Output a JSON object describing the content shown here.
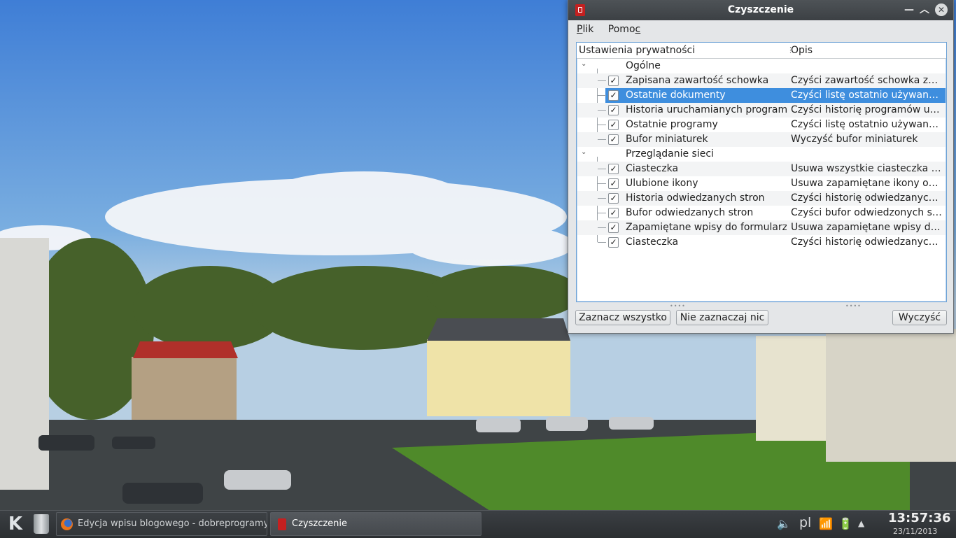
{
  "window": {
    "title": "Czyszczenie",
    "menu": [
      {
        "first": "P",
        "rest": "lik"
      },
      {
        "first": "Pomo",
        "rest_ul": "c"
      }
    ],
    "columns": {
      "setting": "Ustawienia prywatności",
      "description": "Opis"
    },
    "categories": [
      {
        "label": "Ogólne",
        "expanded": true,
        "items": [
          {
            "label": "Zapisana zawartość schowka",
            "description": "Czyści zawartość schowka zapis…",
            "checked": "✓"
          },
          {
            "label": "Ostatnie dokumenty",
            "description": "Czyści listę ostatnio używanych …",
            "checked": "✓",
            "selected": true
          },
          {
            "label": "Historia uruchamianych programów",
            "description": "Czyści historię programów uruc…",
            "checked": "✓"
          },
          {
            "label": "Ostatnie programy",
            "description": "Czyści listę ostatnio używanych …",
            "checked": "✓"
          },
          {
            "label": "Bufor miniaturek",
            "description": "Wyczyść bufor miniaturek",
            "checked": "✓"
          }
        ]
      },
      {
        "label": "Przeglądanie sieci",
        "expanded": true,
        "items": [
          {
            "label": "Ciasteczka",
            "description": "Usuwa wszystkie ciasteczka ust…",
            "checked": "✓"
          },
          {
            "label": "Ulubione ikony",
            "description": "Usuwa zapamiętane ikony odwi…",
            "checked": "✓"
          },
          {
            "label": "Historia odwiedzanych stron",
            "description": "Czyści historię odwiedzanych st…",
            "checked": "✓"
          },
          {
            "label": "Bufor odwiedzanych stron",
            "description": "Czyści bufor odwiedzonych stro…",
            "checked": "✓"
          },
          {
            "label": "Zapamiętane wpisy do formularzy",
            "description": "Usuwa zapamiętane wpisy do fo…",
            "checked": "✓"
          },
          {
            "label": "Ciasteczka",
            "description": "Czyści historię odwiedzanych st…",
            "checked": "✓"
          }
        ]
      }
    ],
    "buttons": {
      "select_all": "Zaznacz wszystko",
      "select_none": "Nie zaznaczaj nic",
      "clean": "Wyczyść"
    }
  },
  "taskbar": {
    "tasks": [
      {
        "label": "Edycja wpisu blogowego - dobreprogramy - M",
        "icon": "firefox-icon"
      },
      {
        "label": "Czyszczenie",
        "icon": "cleanup-icon",
        "active": true
      }
    ],
    "tray": {
      "volume": "🔈",
      "keyboard_layout": "pl",
      "network": "📶",
      "power": "🔋",
      "expand": "▲"
    },
    "clock": {
      "time": "13:57:36",
      "date": "23/11/2013"
    }
  },
  "colors": {
    "selection": "#3e8ede",
    "titlebar": "#474b4f",
    "taskbar": "#323538"
  }
}
